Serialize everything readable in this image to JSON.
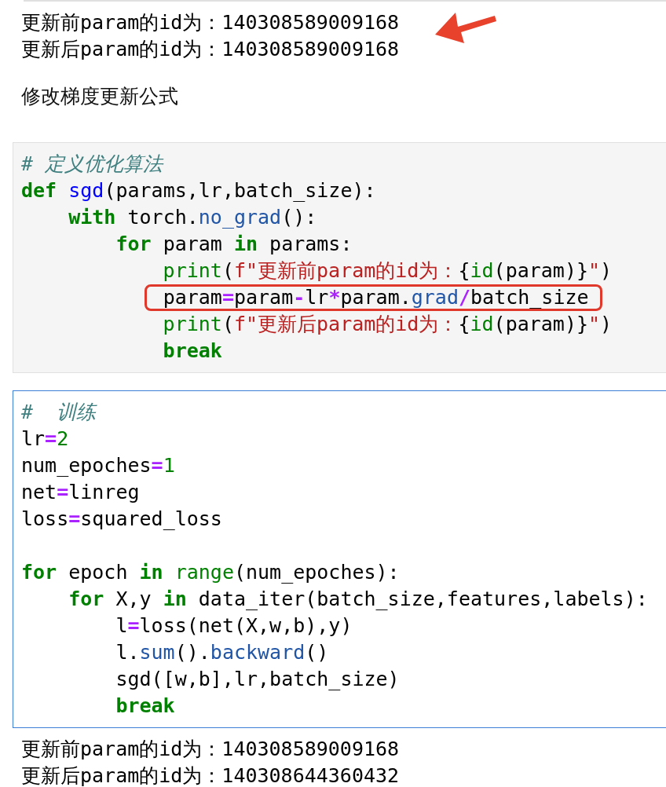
{
  "cells": [
    {
      "kind": "output",
      "annotated": true,
      "lines": [
        "更新前param的id为：140308589009168",
        "更新后param的id为：140308589009168"
      ]
    },
    {
      "kind": "markdown",
      "text": "修改梯度更新公式"
    },
    {
      "kind": "code",
      "selected": false,
      "lines": [
        {
          "kind": "code",
          "highlighted": false,
          "tokens": [
            {
              "kind": "comment",
              "text": "# 定义优化算法"
            }
          ]
        },
        {
          "kind": "code",
          "highlighted": false,
          "tokens": [
            {
              "kind": "keyword",
              "text": "def"
            },
            {
              "kind": "function",
              "text": " sgd"
            },
            {
              "kind": "text",
              "text": "(params,lr,batch_size):"
            }
          ]
        },
        {
          "kind": "code",
          "highlighted": false,
          "tokens": [
            {
              "kind": "keyword",
              "text": "    with"
            },
            {
              "kind": "text",
              "text": " torch."
            },
            {
              "kind": "method",
              "text": "no_grad"
            },
            {
              "kind": "text",
              "text": "():"
            }
          ]
        },
        {
          "kind": "code",
          "highlighted": false,
          "tokens": [
            {
              "kind": "keyword",
              "text": "        for"
            },
            {
              "kind": "text",
              "text": " param "
            },
            {
              "kind": "keyword",
              "text": "in"
            },
            {
              "kind": "text",
              "text": " params:"
            }
          ]
        },
        {
          "kind": "code",
          "highlighted": false,
          "tokens": [
            {
              "kind": "builtin",
              "text": "            print"
            },
            {
              "kind": "text",
              "text": "("
            },
            {
              "kind": "string",
              "text": "f\"更新前param的id为："
            },
            {
              "kind": "text",
              "text": "{"
            },
            {
              "kind": "builtin",
              "text": "id"
            },
            {
              "kind": "text",
              "text": "(param)}"
            },
            {
              "kind": "string",
              "text": "\""
            },
            {
              "kind": "text",
              "text": ")"
            }
          ]
        },
        {
          "kind": "code",
          "highlighted": true,
          "tokens": [
            {
              "kind": "text",
              "text": "            param"
            },
            {
              "kind": "operator",
              "text": "="
            },
            {
              "kind": "text",
              "text": "param"
            },
            {
              "kind": "operator",
              "text": "-"
            },
            {
              "kind": "text",
              "text": "lr"
            },
            {
              "kind": "operator",
              "text": "*"
            },
            {
              "kind": "text",
              "text": "param."
            },
            {
              "kind": "method",
              "text": "grad"
            },
            {
              "kind": "operator",
              "text": "/"
            },
            {
              "kind": "text",
              "text": "batch_size"
            }
          ]
        },
        {
          "kind": "code",
          "highlighted": false,
          "tokens": [
            {
              "kind": "builtin",
              "text": "            print"
            },
            {
              "kind": "text",
              "text": "("
            },
            {
              "kind": "string",
              "text": "f\"更新后param的id为："
            },
            {
              "kind": "text",
              "text": "{"
            },
            {
              "kind": "builtin",
              "text": "id"
            },
            {
              "kind": "text",
              "text": "(param)}"
            },
            {
              "kind": "string",
              "text": "\""
            },
            {
              "kind": "text",
              "text": ")"
            }
          ]
        },
        {
          "kind": "code",
          "highlighted": false,
          "tokens": [
            {
              "kind": "keyword",
              "text": "            break"
            }
          ]
        }
      ]
    },
    {
      "kind": "code",
      "selected": true,
      "lines": [
        {
          "kind": "code",
          "highlighted": false,
          "tokens": [
            {
              "kind": "comment",
              "text": "#  训练"
            }
          ]
        },
        {
          "kind": "code",
          "highlighted": false,
          "tokens": [
            {
              "kind": "text",
              "text": "lr"
            },
            {
              "kind": "operator",
              "text": "="
            },
            {
              "kind": "number",
              "text": "2"
            }
          ]
        },
        {
          "kind": "code",
          "highlighted": false,
          "tokens": [
            {
              "kind": "text",
              "text": "num_epoches"
            },
            {
              "kind": "operator",
              "text": "="
            },
            {
              "kind": "number",
              "text": "1"
            }
          ]
        },
        {
          "kind": "code",
          "highlighted": false,
          "tokens": [
            {
              "kind": "text",
              "text": "net"
            },
            {
              "kind": "operator",
              "text": "="
            },
            {
              "kind": "text",
              "text": "linreg"
            }
          ]
        },
        {
          "kind": "code",
          "highlighted": false,
          "tokens": [
            {
              "kind": "text",
              "text": "loss"
            },
            {
              "kind": "operator",
              "text": "="
            },
            {
              "kind": "text",
              "text": "squared_loss"
            }
          ]
        },
        {
          "kind": "blank"
        },
        {
          "kind": "code",
          "highlighted": false,
          "tokens": [
            {
              "kind": "keyword",
              "text": "for"
            },
            {
              "kind": "text",
              "text": " epoch "
            },
            {
              "kind": "keyword",
              "text": "in"
            },
            {
              "kind": "builtin",
              "text": " range"
            },
            {
              "kind": "text",
              "text": "(num_epoches):"
            }
          ]
        },
        {
          "kind": "code",
          "highlighted": false,
          "tokens": [
            {
              "kind": "keyword",
              "text": "    for"
            },
            {
              "kind": "text",
              "text": " X,y "
            },
            {
              "kind": "keyword",
              "text": "in"
            },
            {
              "kind": "text",
              "text": " data_iter(batch_size,features,labels):"
            }
          ]
        },
        {
          "kind": "code",
          "highlighted": false,
          "tokens": [
            {
              "kind": "text",
              "text": "        l"
            },
            {
              "kind": "operator",
              "text": "="
            },
            {
              "kind": "text",
              "text": "loss(net(X,w,b),y)"
            }
          ]
        },
        {
          "kind": "code",
          "highlighted": false,
          "tokens": [
            {
              "kind": "text",
              "text": "        l."
            },
            {
              "kind": "method",
              "text": "sum"
            },
            {
              "kind": "text",
              "text": "()."
            },
            {
              "kind": "method",
              "text": "backward"
            },
            {
              "kind": "text",
              "text": "()"
            }
          ]
        },
        {
          "kind": "code",
          "highlighted": false,
          "tokens": [
            {
              "kind": "text",
              "text": "        sgd([w,b],lr,batch_size)"
            }
          ]
        },
        {
          "kind": "code",
          "highlighted": false,
          "tokens": [
            {
              "kind": "keyword",
              "text": "        break"
            }
          ]
        }
      ]
    },
    {
      "kind": "output",
      "lines": [
        "更新前param的id为：140308589009168",
        "更新后param的id为：140308644360432"
      ]
    }
  ]
}
